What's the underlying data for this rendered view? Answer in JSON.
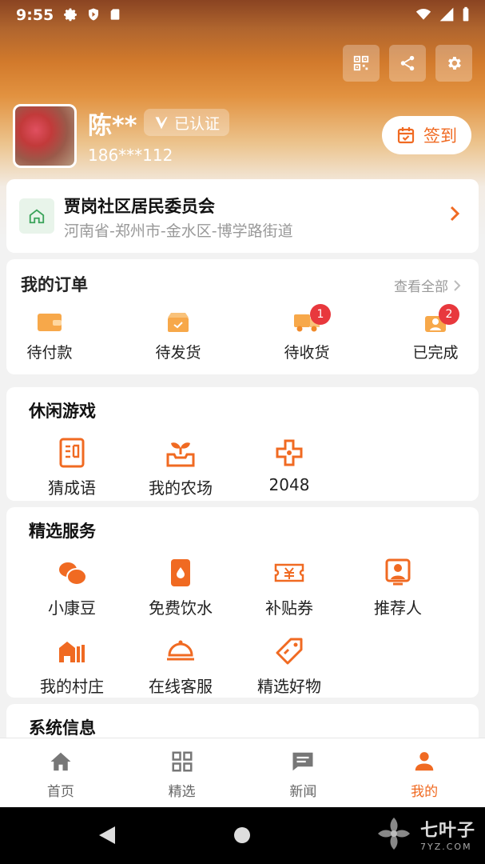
{
  "status_bar": {
    "time": "9:55"
  },
  "user": {
    "name": "陈**",
    "verified_label": "已认证",
    "phone": "186***112",
    "signin_label": "签到"
  },
  "community": {
    "name": "贾岗社区居民委员会",
    "address": "河南省-郑州市-金水区-博学路街道"
  },
  "orders": {
    "title": "我的订单",
    "view_all": "查看全部",
    "items": [
      {
        "label": "待付款",
        "icon": "wallet-icon"
      },
      {
        "label": "待发货",
        "icon": "package-icon"
      },
      {
        "label": "待收货",
        "icon": "truck-icon",
        "badge": "1"
      },
      {
        "label": "已完成",
        "icon": "completed-icon",
        "badge": "2"
      }
    ]
  },
  "games": {
    "title": "休闲游戏",
    "items": [
      {
        "label": "猜成语",
        "icon": "idiom-book-icon"
      },
      {
        "label": "我的农场",
        "icon": "sprout-icon"
      },
      {
        "label": "2048",
        "icon": "gamepad-icon"
      }
    ]
  },
  "services": {
    "title": "精选服务",
    "items": [
      {
        "label": "小康豆",
        "icon": "beans-icon"
      },
      {
        "label": "免费饮水",
        "icon": "water-icon"
      },
      {
        "label": "补贴券",
        "icon": "coupon-icon"
      },
      {
        "label": "推荐人",
        "icon": "referrer-icon"
      },
      {
        "label": "我的村庄",
        "icon": "village-icon"
      },
      {
        "label": "在线客服",
        "icon": "service-bell-icon"
      },
      {
        "label": "精选好物",
        "icon": "tag-icon"
      }
    ]
  },
  "system_info": {
    "title": "系统信息"
  },
  "bottom_nav": {
    "items": [
      {
        "label": "首页",
        "icon": "home-icon"
      },
      {
        "label": "精选",
        "icon": "grid-icon"
      },
      {
        "label": "新闻",
        "icon": "news-icon"
      },
      {
        "label": "我的",
        "icon": "person-icon",
        "active": true
      }
    ]
  },
  "watermark": {
    "brand": "七叶子",
    "domain": "7YZ.COM"
  },
  "colors": {
    "accent": "#f06a22",
    "badge": "#e8383d",
    "community_icon": "#3aa35a"
  }
}
